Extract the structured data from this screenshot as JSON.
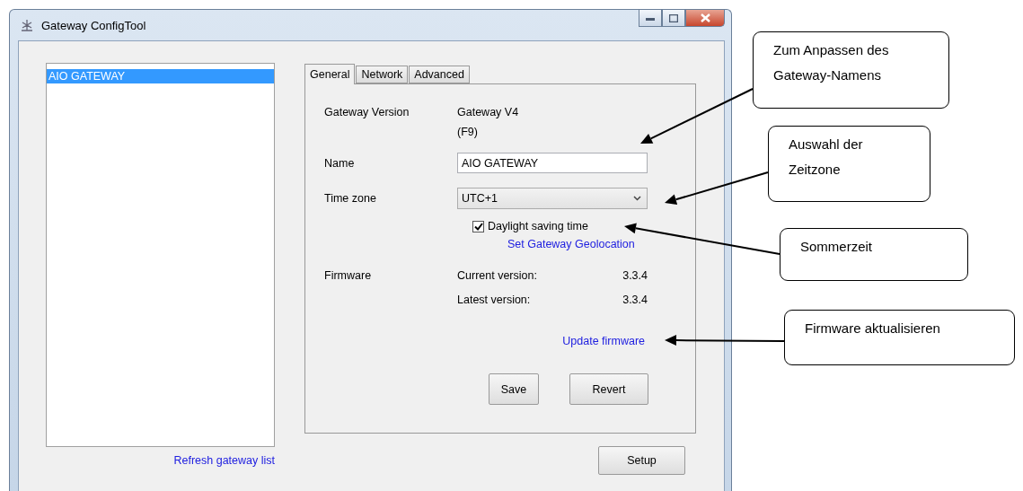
{
  "window": {
    "title": "Gateway ConfigTool"
  },
  "gateway_list": {
    "items": [
      {
        "label": "AIO GATEWAY",
        "selected": true
      }
    ],
    "refresh_link": "Refresh gateway list"
  },
  "tabs": [
    {
      "label": "General",
      "selected": true
    },
    {
      "label": "Network",
      "selected": false
    },
    {
      "label": "Advanced",
      "selected": false
    }
  ],
  "general": {
    "version_label": "Gateway Version",
    "version_lines": [
      "Gateway V4",
      "(F9)"
    ],
    "name_label": "Name",
    "name_value": "AIO GATEWAY",
    "timezone_label": "Time zone",
    "timezone_value": "UTC+1",
    "daylight": {
      "label": "Daylight saving time",
      "checked": true
    },
    "geolocation_link": "Set Gateway Geolocation",
    "firmware_label": "Firmware",
    "firmware_rows": [
      {
        "label": "Current version:",
        "value": "3.3.4"
      },
      {
        "label": "Latest version:",
        "value": "3.3.4"
      }
    ],
    "update_link": "Update firmware",
    "buttons": [
      "Save",
      "Revert"
    ]
  },
  "setup_button": "Setup",
  "callouts": [
    {
      "text": "Zum Anpassen des Gateway-Namens"
    },
    {
      "text": "Auswahl der Zeitzone"
    },
    {
      "text": "Sommerzeit"
    },
    {
      "text": "Firmware aktualisieren"
    }
  ]
}
